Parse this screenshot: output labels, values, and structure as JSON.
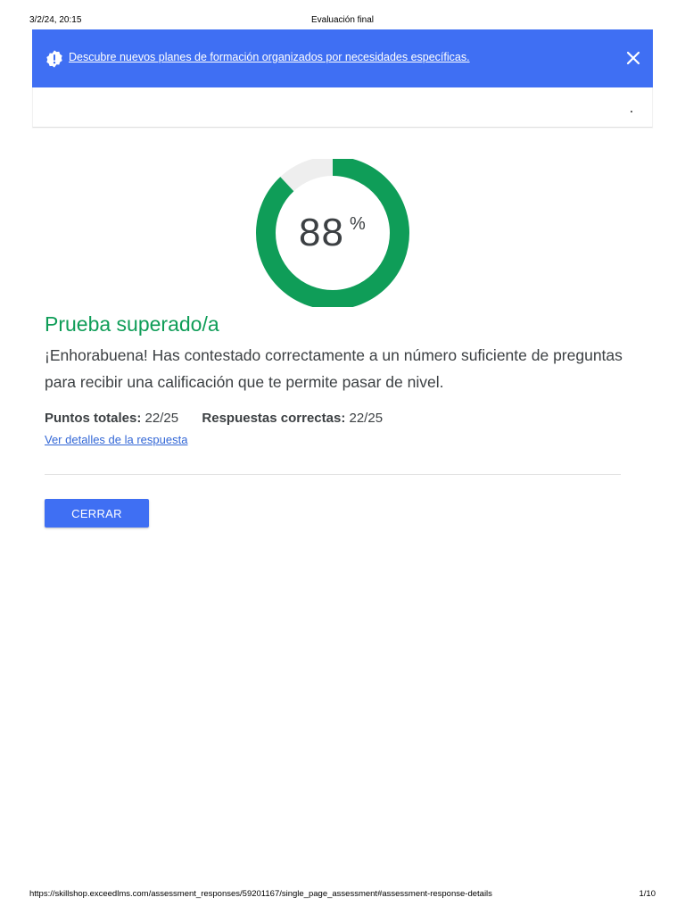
{
  "print_header": {
    "datetime": "3/2/24, 20:15",
    "title": "Evaluación final"
  },
  "banner": {
    "message": "Descubre nuevos planes de formación organizados por necesidades específicas.",
    "background_color": "#3f6ff3",
    "icon": "alert-badge-icon",
    "close_icon": "close-icon"
  },
  "score": {
    "value": "88",
    "unit": "%",
    "percent": 88,
    "ring_color": "#0f9d58",
    "track_color": "#eeeeee"
  },
  "result": {
    "title": "Prueba superado/a",
    "title_color": "#0f9d58",
    "message": "¡Enhorabuena! Has contestado correctamente a un número suficiente de preguntas para recibir una calificación que te permite pasar de nivel."
  },
  "stats": {
    "total_points_label": "Puntos totales:",
    "total_points_value": "22/25",
    "correct_answers_label": "Respuestas correctas:",
    "correct_answers_value": "22/25"
  },
  "details_link": "Ver detalles de la respuesta",
  "close_button": "CERRAR",
  "print_footer": {
    "url": "https://skillshop.exceedlms.com/assessment_responses/59201167/single_page_assessment#assessment-response-details",
    "page": "1/10"
  }
}
